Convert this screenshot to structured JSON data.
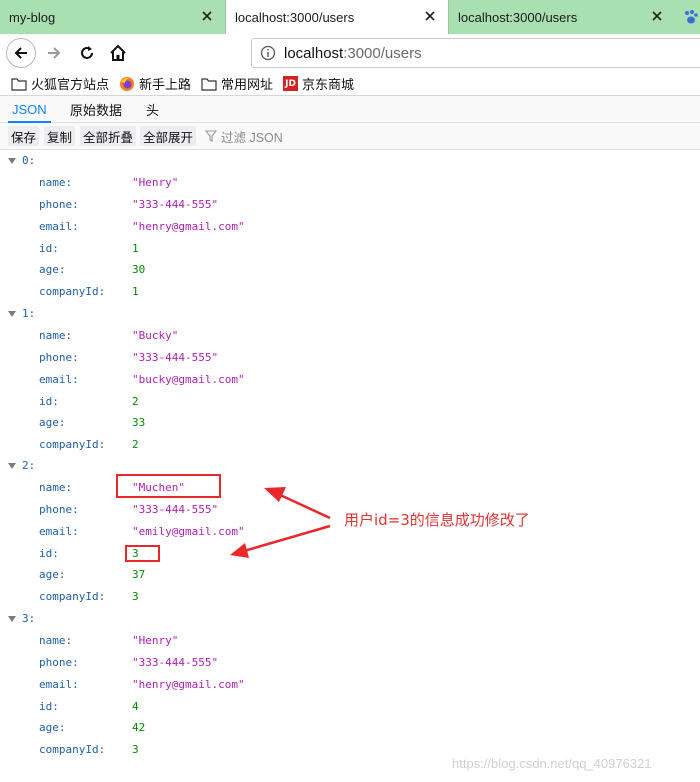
{
  "tabs": [
    {
      "title": "my-blog"
    },
    {
      "title": "localhost:3000/users"
    },
    {
      "title": "localhost:3000/users"
    }
  ],
  "address": {
    "host": "localhost",
    "path": ":3000/users"
  },
  "bookmarks": [
    "火狐官方站点",
    "新手上路",
    "常用网址",
    "京东商城"
  ],
  "jd_logo_text": "JD",
  "viewer_tabs": [
    "JSON",
    "原始数据",
    "头"
  ],
  "toolbar": {
    "save": "保存",
    "copy": "复制",
    "collapse_all": "全部折叠",
    "expand_all": "全部展开",
    "filter_placeholder": "过滤 JSON"
  },
  "users": [
    {
      "index": "0:",
      "name": "\"Henry\"",
      "phone": "\"333-444-555\"",
      "email": "\"henry@gmail.com\"",
      "id": "1",
      "age": "30",
      "companyId": "1"
    },
    {
      "index": "1:",
      "name": "\"Bucky\"",
      "phone": "\"333-444-555\"",
      "email": "\"bucky@gmail.com\"",
      "id": "2",
      "age": "33",
      "companyId": "2"
    },
    {
      "index": "2:",
      "name": "\"Muchen\"",
      "phone": "\"333-444-555\"",
      "email": "\"emily@gmail.com\"",
      "id": "3",
      "age": "37",
      "companyId": "3"
    },
    {
      "index": "3:",
      "name": "\"Henry\"",
      "phone": "\"333-444-555\"",
      "email": "\"henry@gmail.com\"",
      "id": "4",
      "age": "42",
      "companyId": "3"
    }
  ],
  "keys": {
    "name": "name:",
    "phone": "phone:",
    "email": "email:",
    "id": "id:",
    "age": "age:",
    "companyId": "companyId:"
  },
  "annotation": "用户id=3的信息成功修改了",
  "watermark": "https://blog.csdn.net/qq_40976321",
  "colors": {
    "tabstrip": "#a8e0b1",
    "string": "#b01eb5",
    "number": "#058b00",
    "key": "#1f5faa",
    "annotation": "#e9282b",
    "active_tab_accent": "#0a84ff"
  }
}
